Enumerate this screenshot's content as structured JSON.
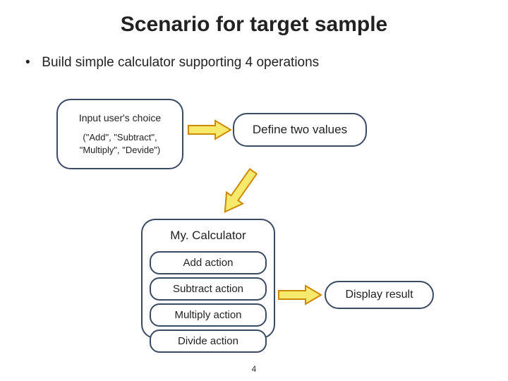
{
  "title": "Scenario for target sample",
  "bullet": {
    "marker": "•",
    "text": "Build simple calculator supporting 4 operations"
  },
  "boxes": {
    "input": {
      "line1": "Input user's choice",
      "line2": "(\"Add\", \"Subtract\", \"Multiply\", \"Devide\")"
    },
    "define": "Define two values",
    "calculator": {
      "header": "My. Calculator",
      "actions": [
        "Add action",
        "Subtract action",
        "Multiply action",
        "Divide action"
      ]
    },
    "display": "Display result"
  },
  "colors": {
    "border": "#3b4a63",
    "arrowFill": "#f6e96b",
    "arrowStroke": "#cc8a00"
  },
  "pageNumber": "4"
}
